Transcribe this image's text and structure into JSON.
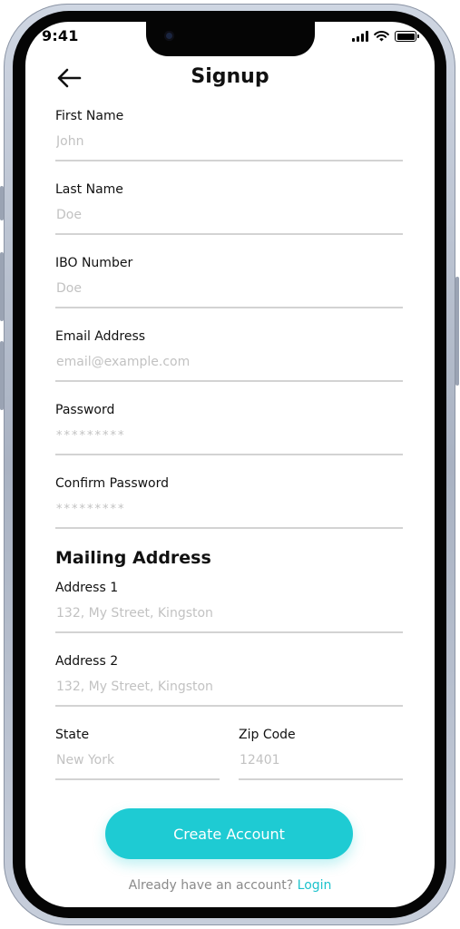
{
  "status_bar": {
    "time": "9:41"
  },
  "header": {
    "title": "Signup"
  },
  "fields": {
    "first_name": {
      "label": "First Name",
      "placeholder": "John"
    },
    "last_name": {
      "label": "Last Name",
      "placeholder": "Doe"
    },
    "ibo_number": {
      "label": "IBO Number",
      "placeholder": "Doe"
    },
    "email": {
      "label": "Email Address",
      "placeholder": "email@example.com"
    },
    "password": {
      "label": "Password",
      "placeholder": "*********"
    },
    "confirm_password": {
      "label": "Confirm Password",
      "placeholder": "*********"
    }
  },
  "mailing": {
    "title": "Mailing Address",
    "address1": {
      "label": "Address 1",
      "placeholder": "132, My Street, Kingston"
    },
    "address2": {
      "label": "Address 2",
      "placeholder": "132, My Street, Kingston"
    },
    "state": {
      "label": "State",
      "placeholder": "New York"
    },
    "zip": {
      "label": "Zip Code",
      "placeholder": "12401"
    }
  },
  "actions": {
    "create_label": "Create Account",
    "footer_text": "Already have an account?",
    "login_label": "Login"
  },
  "colors": {
    "accent": "#1ecbd3",
    "link": "#1ec3cc",
    "divider": "#d3d3d3",
    "placeholder": "#c2c2c2"
  },
  "icons": {
    "back": "arrow-left-icon",
    "signal": "cellular-signal-icon",
    "wifi": "wifi-icon",
    "battery": "battery-icon"
  }
}
